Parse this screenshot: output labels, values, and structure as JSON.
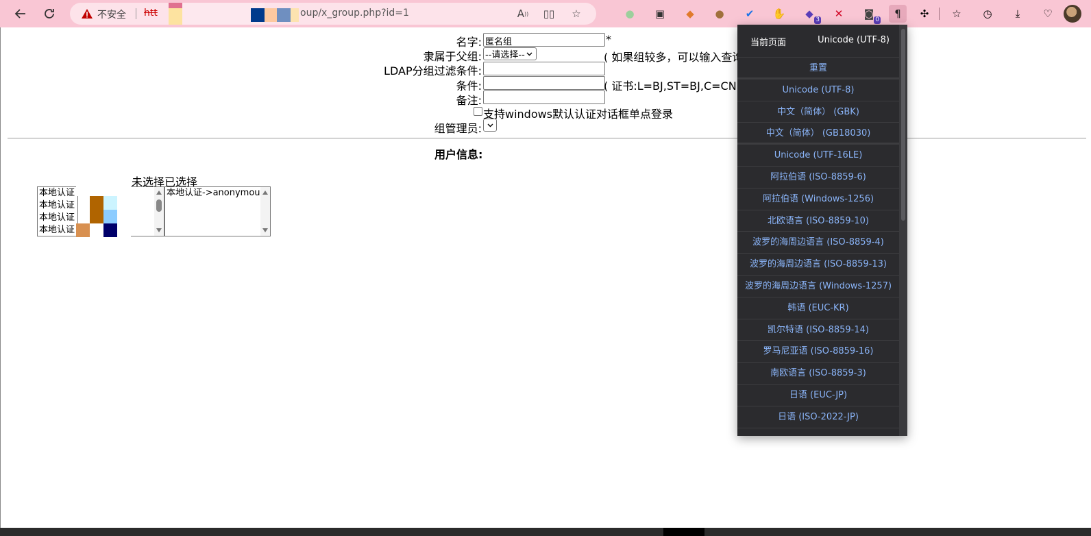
{
  "browser": {
    "security_label": "不安全",
    "url_scheme": "htt",
    "url_path": "oup/x_group.php?id=1",
    "icons": {
      "back": "back-arrow-icon",
      "refresh": "refresh-icon",
      "warning": "warning-triangle-icon",
      "read_aloud": "read-aloud-icon",
      "split_screen": "split-screen-icon",
      "favorite": "star-icon"
    },
    "extensions": [
      {
        "name": "circle-extension-icon",
        "glyph": "●",
        "color": "#9ccf9c"
      },
      {
        "name": "floppy-extension-icon",
        "glyph": "▣",
        "color": "#333333"
      },
      {
        "name": "fox-extension-icon",
        "glyph": "◆",
        "color": "#e07a2c"
      },
      {
        "name": "cookie-extension-icon",
        "glyph": "●",
        "color": "#a0703c"
      },
      {
        "name": "check-extension-icon",
        "glyph": "✔",
        "color": "#1a73e8"
      },
      {
        "name": "hand-extension-icon",
        "glyph": "✋",
        "color": "#d00000"
      },
      {
        "name": "cube-extension-icon",
        "glyph": "◆",
        "color": "#5a3db8",
        "badge": "3"
      },
      {
        "name": "x-extension-icon",
        "glyph": "✕",
        "color": "#d00020"
      },
      {
        "name": "robot-extension-icon",
        "glyph": "◙",
        "color": "#444444",
        "badge": "0"
      },
      {
        "name": "pilcrow-extension-icon",
        "glyph": "¶",
        "color": "#222222"
      }
    ],
    "right_icons": [
      "puzzle-icon",
      "favorites-icon",
      "history-icon",
      "download-icon",
      "heart-pulse-icon"
    ]
  },
  "form": {
    "name_label": "名字:",
    "name_value": "匿名组",
    "required_mark": "*",
    "parent_label": "隶属于父组:",
    "parent_select": "--请选择--",
    "parent_hint": "( 如果组较多，可以输入查询",
    "ldap_label": "LDAP分组过滤条件:",
    "ldap_value": "",
    "condition_label": "条件:",
    "condition_value": "",
    "condition_hint": "( 证书:L=BJ,ST=BJ,C=CN )",
    "remark_label": "备注:",
    "remark_value": "",
    "sso_checkbox_label": "支持windows默认认证对话框单点登录",
    "manager_label": "组管理员:"
  },
  "user_info": {
    "title": "用户信息:",
    "unselected_label": "未选择",
    "selected_label": "已选择",
    "unselected_items": [
      "本地认证",
      "本地认证",
      "本地认证",
      "本地认证"
    ],
    "selected_items": [
      "本地认证->anonymous"
    ]
  },
  "encoding_menu": {
    "current_page_label": "当前页面",
    "current_encoding": "Unicode (UTF-8)",
    "reset_label": "重置",
    "options": [
      "Unicode (UTF-8)",
      "中文（简体） (GBK)",
      "中文（简体） (GB18030)",
      "Unicode (UTF-16LE)",
      "阿拉伯语 (ISO-8859-6)",
      "阿拉伯语 (Windows-1256)",
      "北欧语言 (ISO-8859-10)",
      "波罗的海周边语言 (ISO-8859-4)",
      "波罗的海周边语言 (ISO-8859-13)",
      "波罗的海周边语言 (Windows-1257)",
      "韩语 (EUC-KR)",
      "凯尔特语 (ISO-8859-14)",
      "罗马尼亚语 (ISO-8859-16)",
      "南欧语言 (ISO-8859-3)",
      "日语 (EUC-JP)",
      "日语 (ISO-2022-JP)"
    ]
  },
  "colors": {
    "toolbar_bg": "#f9c6d4",
    "address_bg": "#fde3ea",
    "menu_bg": "#2b2b2e",
    "menu_link": "#8ab4f8",
    "warning": "#c00000"
  }
}
